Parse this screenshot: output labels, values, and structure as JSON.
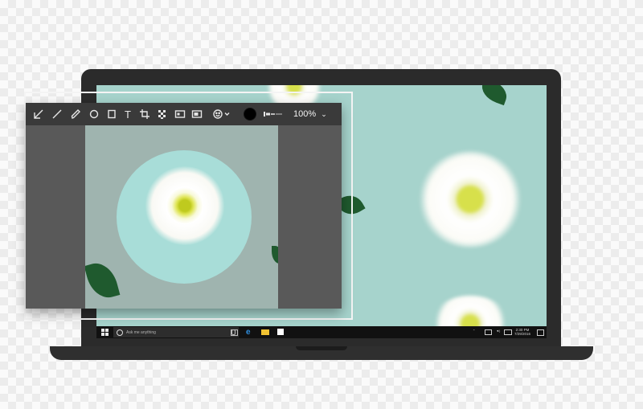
{
  "editor": {
    "tools": [
      {
        "icon": "arrow-icon"
      },
      {
        "icon": "line-icon"
      },
      {
        "icon": "pencil-icon"
      },
      {
        "icon": "ellipse-icon"
      },
      {
        "icon": "rectangle-icon"
      },
      {
        "icon": "text-icon",
        "label": "T"
      },
      {
        "icon": "crop-icon"
      },
      {
        "icon": "mosaic-icon"
      },
      {
        "icon": "highlight-icon"
      },
      {
        "icon": "blur-icon"
      },
      {
        "icon": "emoji-icon"
      }
    ],
    "color": "#000000",
    "zoom": "100%"
  },
  "taskbar": {
    "search_placeholder": "Ask me anything",
    "time": "2:30 PM",
    "date": "7/29/2016"
  },
  "colors": {
    "screen_background": "#a6d3cc",
    "highlight_circle": "#a8ddd8",
    "toolbar": "#3a3a3a"
  }
}
